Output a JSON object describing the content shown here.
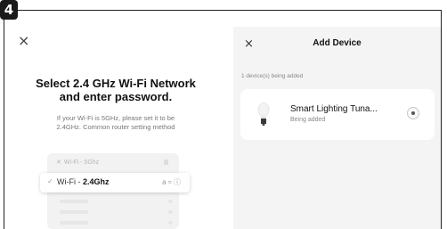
{
  "step_number": "4",
  "left_screen": {
    "close_glyph": "×",
    "title_line1": "Select 2.4 GHz Wi-Fi Network",
    "title_line2": "and enter password.",
    "desc_line1": "If your Wi-Fi is 5GHz, please set it to be",
    "desc_line2": "2.4GHz. Common router setting method",
    "wifi_list": {
      "faded_network": "Wi-Fi - 5Ghz",
      "selected_prefix": "Wi-Fi - ",
      "selected_band": "2.4Ghz",
      "check_glyph": "✓",
      "icons": [
        "lock-icon",
        "wifi-icon",
        "info-icon"
      ]
    }
  },
  "right_screen": {
    "close_glyph": "×",
    "title": "Add Device",
    "subtitle": "1 device(s) being added",
    "device": {
      "name": "Smart Lighting Tuna...",
      "status": "Being added",
      "icon": "bulb-icon"
    }
  },
  "colors": {
    "accent": "#111111",
    "panel_bg": "#f4f4f4",
    "muted_text": "#888888"
  }
}
